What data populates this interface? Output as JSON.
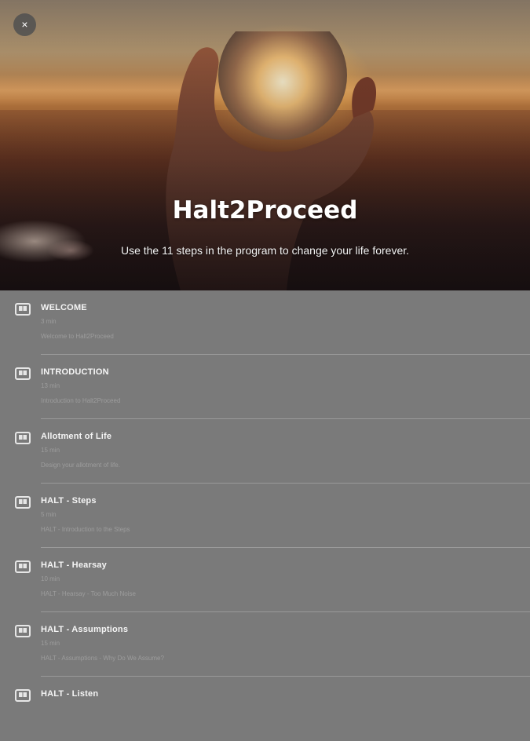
{
  "header": {
    "close_label": "×",
    "title": "Halt2Proceed",
    "subtitle": "Use the 11 steps in the program to change your life forever."
  },
  "lessons": [
    {
      "title": "WELCOME",
      "duration": "3 min",
      "description": "Welcome to Halt2Proceed"
    },
    {
      "title": "INTRODUCTION",
      "duration": "13 min",
      "description": "Introduction to Halt2Proceed"
    },
    {
      "title": "Allotment of Life",
      "duration": "15 min",
      "description": "Design your allotment of life."
    },
    {
      "title": "HALT - Steps",
      "duration": "5 min",
      "description": "HALT - Introduction to the Steps"
    },
    {
      "title": "HALT - Hearsay",
      "duration": "10 min",
      "description": "HALT - Hearsay - Too Much Noise"
    },
    {
      "title": "HALT - Assumptions",
      "duration": "15 min",
      "description": "HALT - Assumptions - Why Do We Assume?"
    },
    {
      "title": "HALT - Listen",
      "duration": "",
      "description": ""
    }
  ],
  "icons": {
    "lesson": "book-icon",
    "close": "close-icon"
  },
  "colors": {
    "list_background": "#7a7a7a",
    "title_text": "#f5f5f5",
    "meta_text": "#9d9d9d"
  }
}
